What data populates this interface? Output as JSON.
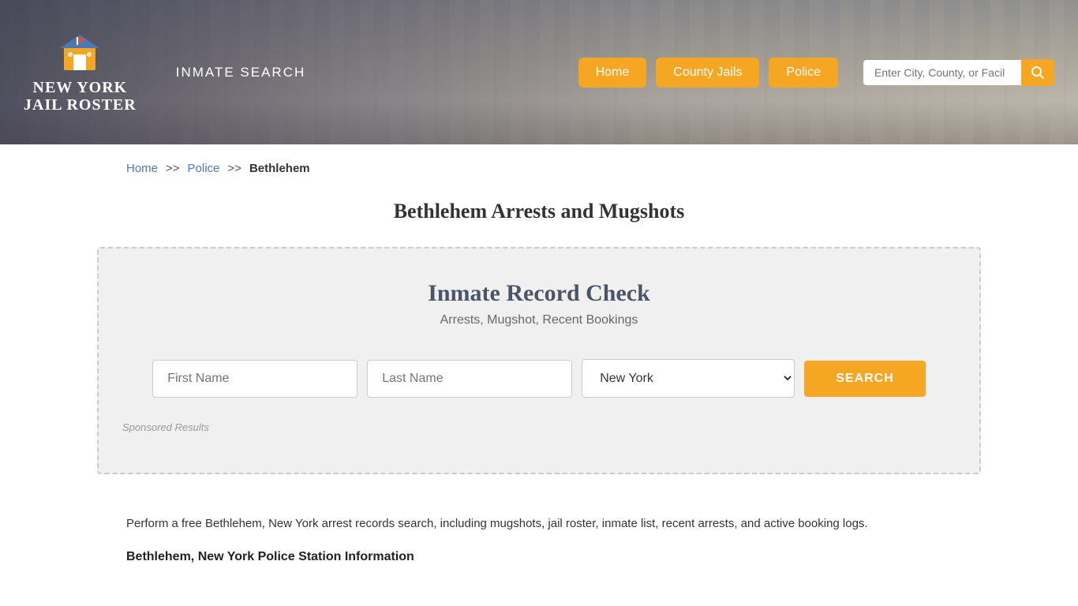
{
  "header": {
    "logo_line1": "NEW YORK",
    "logo_line2": "JAIL ROSTER",
    "inmate_search_label": "INMATE SEARCH",
    "nav": {
      "home_label": "Home",
      "county_jails_label": "County Jails",
      "police_label": "Police"
    },
    "search_placeholder": "Enter City, County, or Facil"
  },
  "breadcrumb": {
    "home_label": "Home",
    "police_label": "Police",
    "current_label": "Bethlehem",
    "sep": ">>"
  },
  "page_title": "Bethlehem Arrests and Mugshots",
  "record_check": {
    "title": "Inmate Record Check",
    "subtitle": "Arrests, Mugshot, Recent Bookings",
    "first_name_placeholder": "First Name",
    "last_name_placeholder": "Last Name",
    "state_default": "New York",
    "search_label": "SEARCH",
    "sponsored_label": "Sponsored Results"
  },
  "content": {
    "paragraph": "Perform a free Bethlehem, New York arrest records search, including mugshots, jail roster, inmate list, recent arrests, and active booking logs.",
    "subheading": "Bethlehem, New York Police Station Information"
  }
}
